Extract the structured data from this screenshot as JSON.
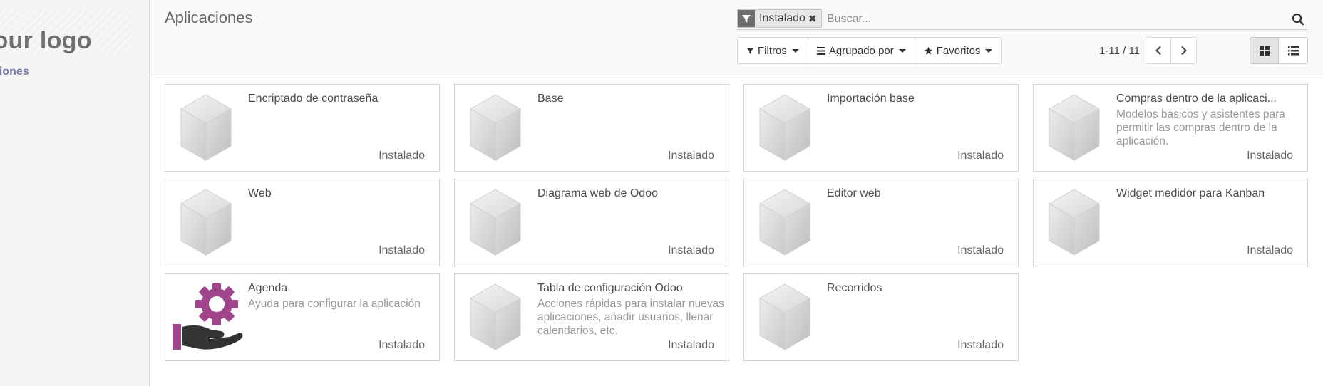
{
  "sidebar": {
    "logo_text": "Your logo",
    "menu_item": "Aplicaciones"
  },
  "header": {
    "title": "Aplicaciones"
  },
  "search": {
    "facet_label": "Instalado",
    "placeholder": "Buscar..."
  },
  "toolbar": {
    "filters_label": "Filtros",
    "groupby_label": "Agrupado por",
    "favorites_label": "Favoritos"
  },
  "pager": {
    "value": "1-11",
    "separator": " / ",
    "total": "11"
  },
  "colors": {
    "agenda_icon_purple": "#a0458b",
    "agenda_hand": "#333333"
  },
  "apps": [
    {
      "name": "Encriptado de contraseña",
      "description": "",
      "status": "Instalado",
      "icon": "module-cube-icon"
    },
    {
      "name": "Base",
      "description": "",
      "status": "Instalado",
      "icon": "module-cube-icon"
    },
    {
      "name": "Importación base",
      "description": "",
      "status": "Instalado",
      "icon": "module-cube-icon"
    },
    {
      "name": "Compras dentro de la aplicaci...",
      "description": "Modelos básicos y asistentes para permitir las compras dentro de la aplicación.",
      "status": "Instalado",
      "icon": "module-cube-icon"
    },
    {
      "name": "Web",
      "description": "",
      "status": "Instalado",
      "icon": "module-cube-icon"
    },
    {
      "name": "Diagrama web de Odoo",
      "description": "",
      "status": "Instalado",
      "icon": "module-cube-icon"
    },
    {
      "name": "Editor web",
      "description": "",
      "status": "Instalado",
      "icon": "module-cube-icon"
    },
    {
      "name": "Widget medidor para Kanban",
      "description": "",
      "status": "Instalado",
      "icon": "module-cube-icon"
    },
    {
      "name": "Agenda",
      "description": "Ayuda para configurar la aplicación",
      "status": "Instalado",
      "icon": "gear-hand-icon"
    },
    {
      "name": "Tabla de configuración Odoo",
      "description": "Acciones rápidas para instalar nuevas aplicaciones, añadir usuarios, llenar calendarios, etc.",
      "status": "Instalado",
      "icon": "module-cube-icon"
    },
    {
      "name": "Recorridos",
      "description": "",
      "status": "Instalado",
      "icon": "module-cube-icon"
    }
  ]
}
